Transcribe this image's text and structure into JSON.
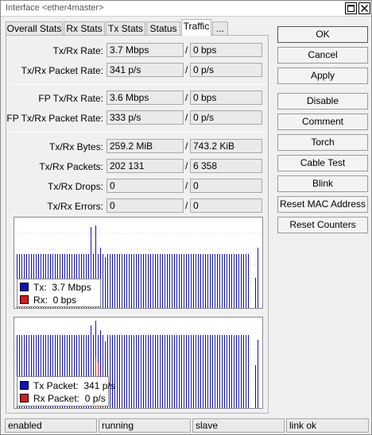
{
  "window": {
    "title": "Interface <ether4master>"
  },
  "tabs": [
    "Overall Stats",
    "Rx Stats",
    "Tx Stats",
    "Status",
    "Traffic",
    "..."
  ],
  "active_tab": "Traffic",
  "fields": [
    {
      "label": "Tx/Rx Rate:",
      "tx": "3.7 Mbps",
      "rx": "0 bps"
    },
    {
      "label": "Tx/Rx Packet Rate:",
      "tx": "341 p/s",
      "rx": "0 p/s"
    },
    {
      "label": "FP Tx/Rx Rate:",
      "tx": "3.6 Mbps",
      "rx": "0 bps"
    },
    {
      "label": "FP Tx/Rx Packet Rate:",
      "tx": "333 p/s",
      "rx": "0 p/s"
    },
    {
      "label": "Tx/Rx Bytes:",
      "tx": "259.2 MiB",
      "rx": "743.2 KiB"
    },
    {
      "label": "Tx/Rx Packets:",
      "tx": "202 131",
      "rx": "6 358"
    },
    {
      "label": "Tx/Rx Drops:",
      "tx": "0",
      "rx": "0"
    },
    {
      "label": "Tx/Rx Errors:",
      "tx": "0",
      "rx": "0"
    }
  ],
  "traffic_graph": {
    "legend": [
      {
        "label": "Tx:",
        "value": "3.7 Mbps",
        "color": "#1010c8"
      },
      {
        "label": "Rx:",
        "value": "0 bps",
        "color": "#e01818"
      }
    ]
  },
  "packet_graph": {
    "legend": [
      {
        "label": "Tx Packet:",
        "value": "341 p/s",
        "color": "#1010c8"
      },
      {
        "label": "Rx Packet:",
        "value": "0 p/s",
        "color": "#e01818"
      }
    ]
  },
  "buttons": [
    "OK",
    "Cancel",
    "Apply",
    "Disable",
    "Comment",
    "Torch",
    "Cable Test",
    "Blink",
    "Reset MAC Address",
    "Reset Counters"
  ],
  "status_bar": [
    "enabled",
    "running",
    "slave",
    "link ok"
  ],
  "colors": {
    "tx": "#1010c8",
    "rx": "#e01818"
  }
}
